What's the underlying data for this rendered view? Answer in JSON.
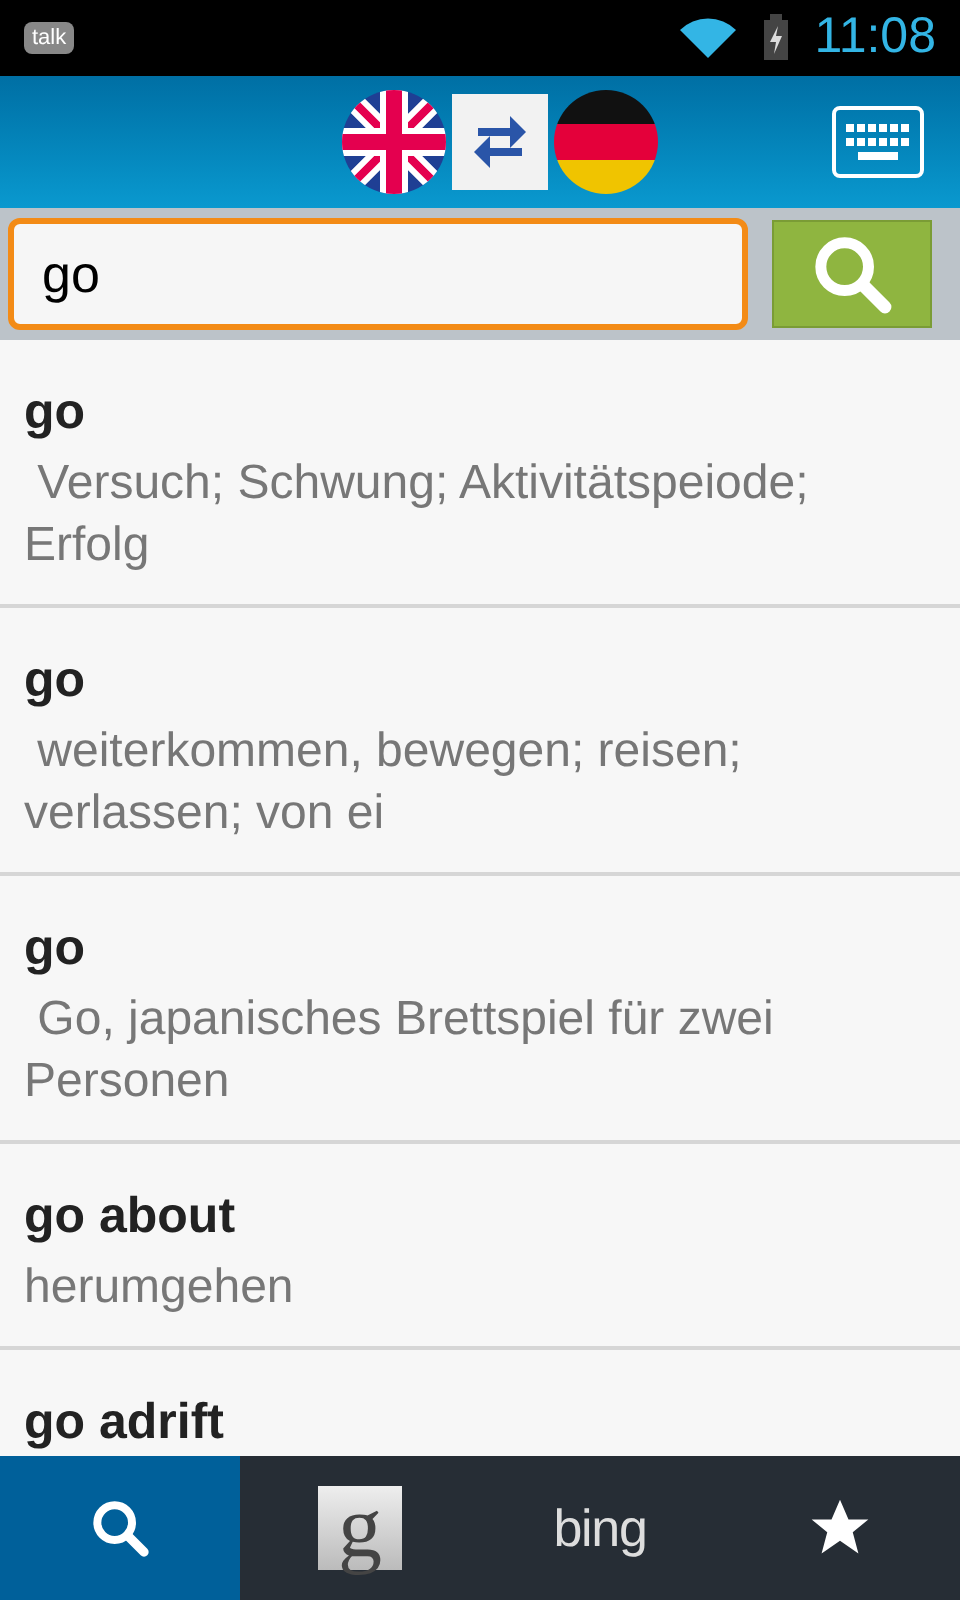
{
  "status_bar": {
    "app_icon_label": "talk",
    "time": "11:08"
  },
  "search": {
    "value": "go"
  },
  "results": [
    {
      "term": "go",
      "translation": " Versuch; Schwung; Aktivitätspeiode; Erfolg"
    },
    {
      "term": "go",
      "translation": " weiterkommen, bewegen; reisen; verlassen; von ei"
    },
    {
      "term": "go",
      "translation": " Go, japanisches Brettspiel für zwei Personen"
    },
    {
      "term": "go about",
      "translation": "herumgehen"
    },
    {
      "term": "go adrift"
    }
  ],
  "bottom_tabs": [
    {
      "kind": "search",
      "selected": true
    },
    {
      "kind": "google",
      "label": "g",
      "selected": false
    },
    {
      "kind": "bing",
      "label": "bing",
      "selected": false
    },
    {
      "kind": "favorites",
      "selected": false
    }
  ]
}
